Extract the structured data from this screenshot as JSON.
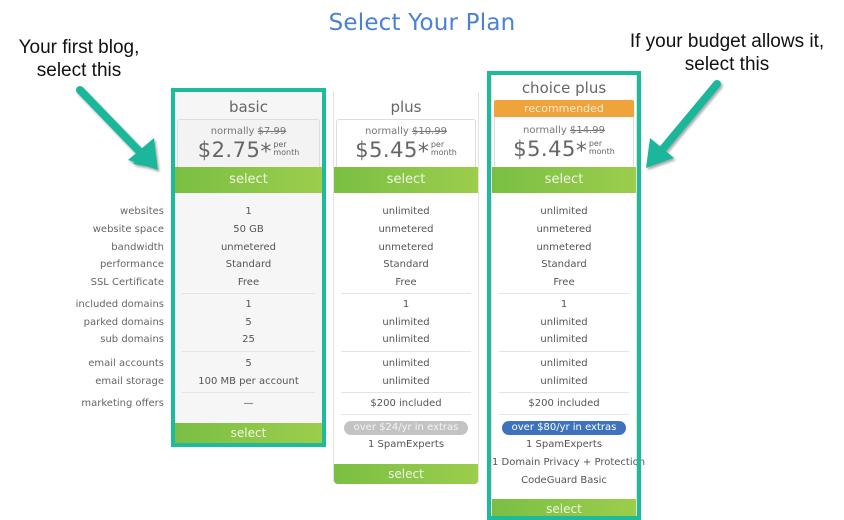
{
  "page": {
    "title": "Select Your Plan"
  },
  "annotations": {
    "left": [
      "Your first blog,",
      "select this"
    ],
    "right": [
      "If your budget allows it,",
      "select this"
    ],
    "highlight_color": "#1dba9c"
  },
  "feature_labels": [
    "websites",
    "website space",
    "bandwidth",
    "performance",
    "SSL Certificate",
    "included domains",
    "parked domains",
    "sub domains",
    "email accounts",
    "email storage",
    "marketing offers"
  ],
  "plans": [
    {
      "name": "basic",
      "badge": "",
      "normally_label": "normally",
      "normal_price": "$7.99",
      "price": "$2.75",
      "asterisk": "*",
      "per": "per",
      "period": "month",
      "select_label": "select",
      "bottom_select_label": "select",
      "highlighted": true,
      "features": [
        "1",
        "50 GB",
        "unmetered",
        "Standard",
        "Free",
        "1",
        "5",
        "25",
        "5",
        "100 MB per account",
        "—"
      ],
      "extras_pill": "",
      "extras": []
    },
    {
      "name": "plus",
      "badge": "",
      "normally_label": "normally",
      "normal_price": "$10.99",
      "price": "$5.45",
      "asterisk": "*",
      "per": "per",
      "period": "month",
      "select_label": "select",
      "bottom_select_label": "select",
      "highlighted": false,
      "features": [
        "unlimited",
        "unmetered",
        "unmetered",
        "Standard",
        "Free",
        "1",
        "unlimited",
        "unlimited",
        "unlimited",
        "unlimited",
        "$200 included"
      ],
      "extras_pill": "over $24/yr in extras",
      "extras": [
        "1 SpamExperts"
      ]
    },
    {
      "name": "choice plus",
      "badge": "recommended",
      "normally_label": "normally",
      "normal_price": "$14.99",
      "price": "$5.45",
      "asterisk": "*",
      "per": "per",
      "period": "month",
      "select_label": "select",
      "bottom_select_label": "select",
      "highlighted": true,
      "features": [
        "unlimited",
        "unmetered",
        "unmetered",
        "Standard",
        "Free",
        "1",
        "unlimited",
        "unlimited",
        "unlimited",
        "unlimited",
        "$200 included"
      ],
      "extras_pill": "over $80/yr in extras",
      "extras": [
        "1 SpamExperts",
        "1 Domain Privacy + Protection",
        "CodeGuard Basic"
      ]
    }
  ],
  "colors": {
    "title": "#4a80d6",
    "select_green": "#8cc747",
    "recommended_orange": "#f0a33a",
    "pill_blue": "#3e72bf",
    "pill_gray": "#c3c3c3"
  }
}
